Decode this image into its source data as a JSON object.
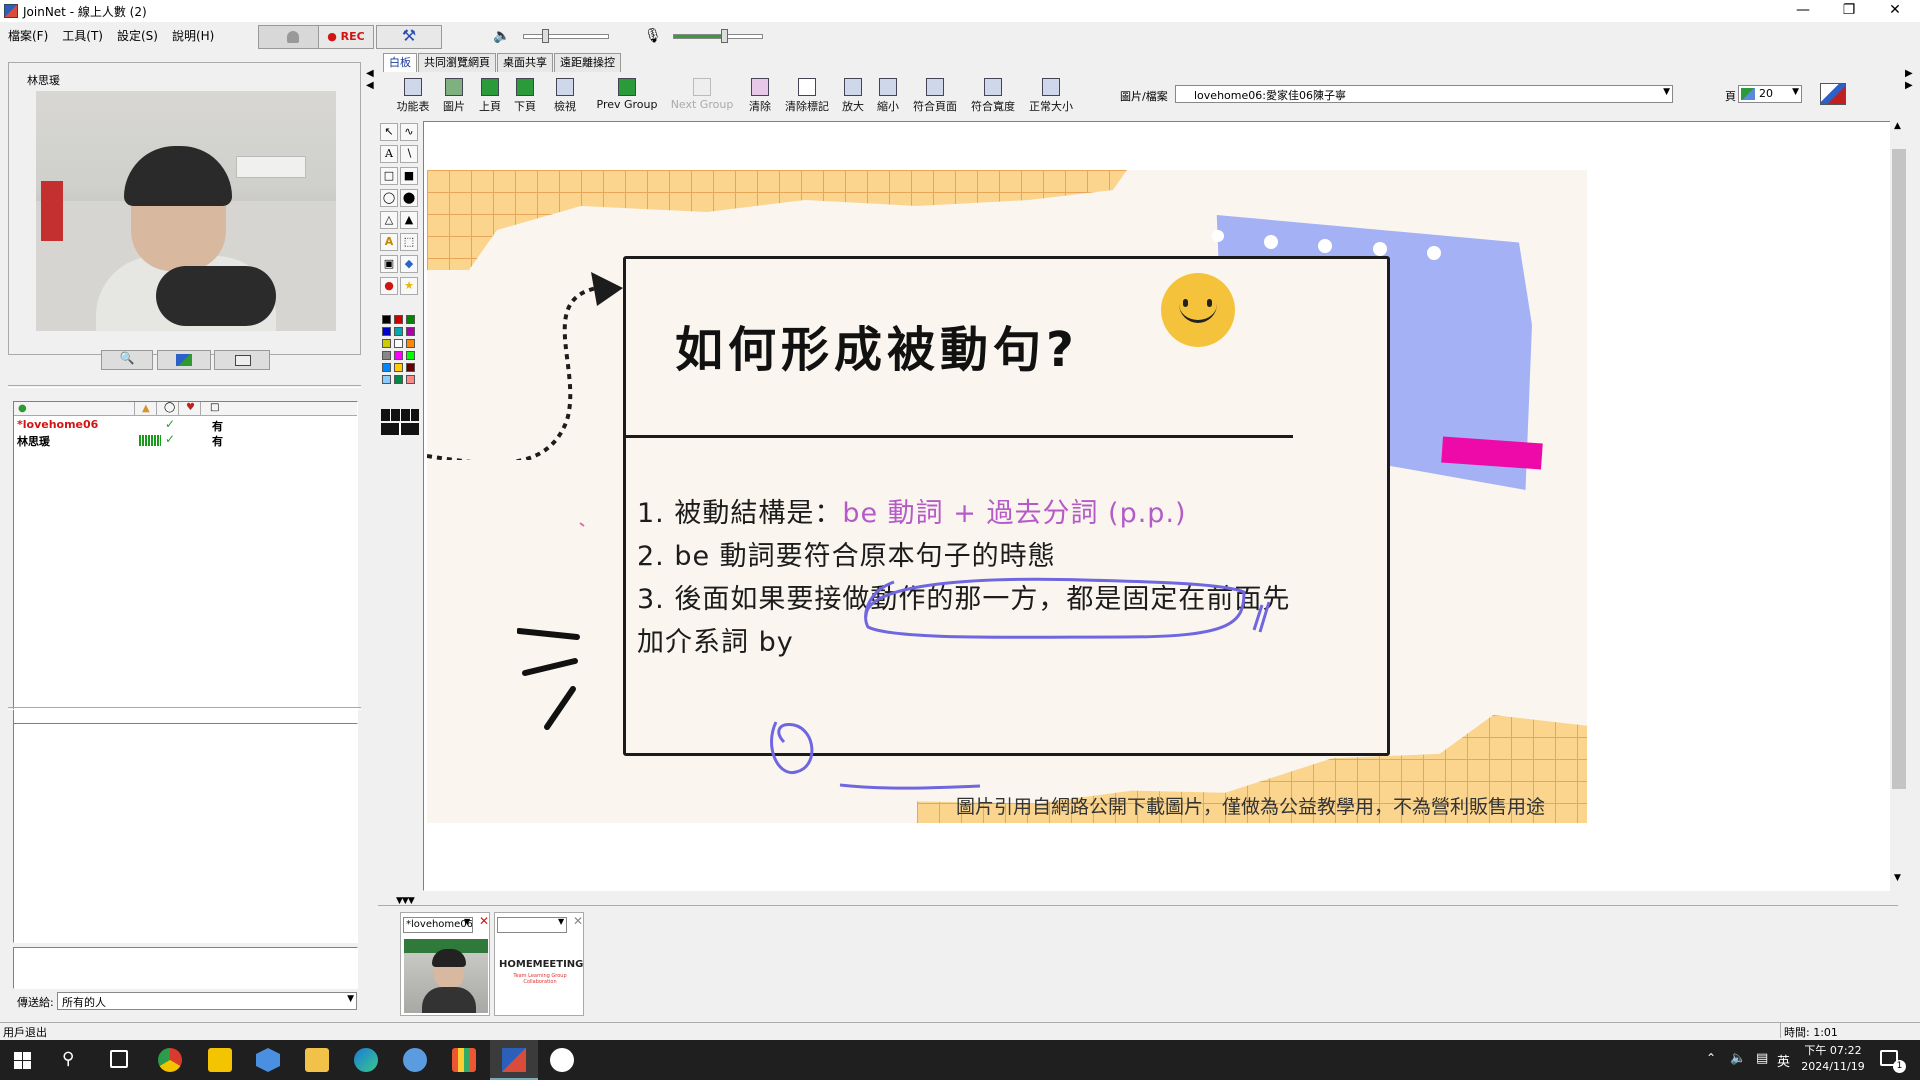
{
  "window": {
    "title": "JoinNet - 線上人數 (2)"
  },
  "menu": [
    "檔案(F)",
    "工具(T)",
    "設定(S)",
    "說明(H)"
  ],
  "toolbar_top": {
    "rec_label": "● REC"
  },
  "video": {
    "user_name": "林思瑗"
  },
  "users": {
    "rows": [
      {
        "name": "*lovehome06",
        "color": "#d01515",
        "check": "✓",
        "has": "有"
      },
      {
        "name": "林思瑗",
        "color": "#000000",
        "check": "✓",
        "has": "有"
      }
    ]
  },
  "chat": {
    "send_to_label": "傳送給:",
    "send_to_value": "所有的人"
  },
  "tabs": [
    "白板",
    "共同瀏覽網頁",
    "桌面共享",
    "遠距離操控"
  ],
  "whiteboard_tools": [
    {
      "label": "功能表",
      "enabled": true
    },
    {
      "label": "圖片",
      "enabled": true
    },
    {
      "label": "上頁",
      "enabled": true
    },
    {
      "label": "下頁",
      "enabled": true
    },
    {
      "label": "檢視",
      "enabled": true
    },
    {
      "label": "Prev Group",
      "enabled": true
    },
    {
      "label": "Next Group",
      "enabled": false
    },
    {
      "label": "清除",
      "enabled": true
    },
    {
      "label": "清除標記",
      "enabled": true
    },
    {
      "label": "放大",
      "enabled": true
    },
    {
      "label": "縮小",
      "enabled": true
    },
    {
      "label": "符合頁面",
      "enabled": true
    },
    {
      "label": "符合寬度",
      "enabled": true
    },
    {
      "label": "正常大小",
      "enabled": true
    }
  ],
  "file": {
    "label": "圖片/檔案",
    "value": "lovehome06:愛家佳06陳子寧"
  },
  "page": {
    "label": "頁",
    "value": "20"
  },
  "slide": {
    "title": "如何形成被動句?",
    "line1_prefix": "1. 被動結構是：",
    "line1_highlight": "be 動詞 + 過去分詞 (p.p.)",
    "line2": "2. be 動詞要符合原本句子的時態",
    "line3a": "3. 後面如果要接做動作的那一方，都是固定在前面先",
    "line3b": "加介系詞 by",
    "footer": "圖片引用自網路公開下載圖片，僅做為公益教學用，不為營利販售用途",
    "highlight_color": "#b55ac7",
    "ink_color": "#6f66e0"
  },
  "thumbs": {
    "user1": "*lovehome06",
    "logo": "HOMEMEETING",
    "logo_sub": "Team Learning Group Collaboration"
  },
  "status": {
    "left": "用戶退出",
    "right": "時間: 1:01"
  },
  "tray": {
    "lang": "英",
    "time": "下午 07:22",
    "date": "2024/11/19",
    "notif": "1"
  },
  "colors": {
    "accent": "#1a3a9a",
    "rec": "#d01515"
  },
  "icons": [
    "search-icon",
    "chrome-icon",
    "edge-icon",
    "folder-icon",
    "windows-start-icon",
    "task-view-icon"
  ]
}
